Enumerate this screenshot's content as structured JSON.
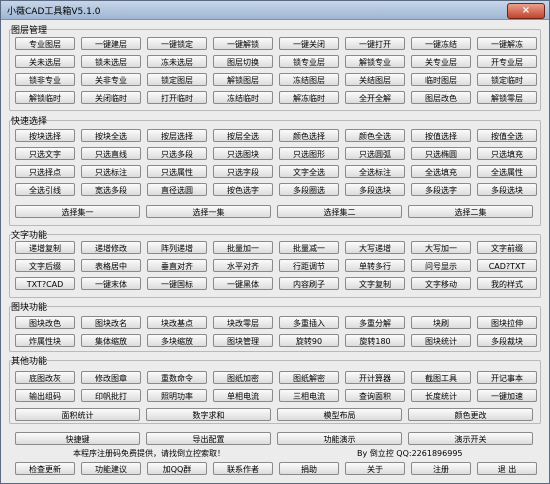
{
  "window": {
    "title": "小薇CAD工具箱V5.1.0",
    "close_symbol": "×"
  },
  "sections": {
    "layers": {
      "label": "图层管理",
      "buttons": [
        "专业图层",
        "一键建层",
        "一键锁定",
        "一键解锁",
        "一键关闭",
        "一键打开",
        "一键冻结",
        "一键解冻",
        "关未选层",
        "锁未选层",
        "冻未选层",
        "图层切换",
        "锁专业层",
        "解锁专业",
        "关专业层",
        "开专业层",
        "锁非专业",
        "关非专业",
        "锁定图层",
        "解锁图层",
        "冻结图层",
        "关结图层",
        "临时图层",
        "锁定临时",
        "解锁临时",
        "关闭临时",
        "打开临时",
        "冻结临时",
        "解冻临时",
        "全开全解",
        "图层改色",
        "解锁零层"
      ]
    },
    "select": {
      "label": "快速选择",
      "buttons": [
        "按块选择",
        "按块全选",
        "按层选择",
        "按层全选",
        "颜色选择",
        "颜色全选",
        "按值选择",
        "按值全选",
        "只选文字",
        "只选直线",
        "只选多段",
        "只选图块",
        "只选图形",
        "只选圆弧",
        "只选椭圆",
        "只选填充",
        "只选择点",
        "只选标注",
        "只选属性",
        "只选字段",
        "文字全选",
        "全选标注",
        "全选填充",
        "全选属性",
        "全选引线",
        "宽选多段",
        "直径选圆",
        "按色选字",
        "多段圈选",
        "多段选块",
        "多段选字",
        "多段选块"
      ],
      "sets": [
        "选择集一",
        "选择一集",
        "选择集二",
        "选择二集"
      ]
    },
    "text": {
      "label": "文字功能",
      "buttons": [
        "递增复制",
        "递增修改",
        "阵列递增",
        "批量加一",
        "批量减一",
        "大写递增",
        "大写加一",
        "文字前缀",
        "文字后缀",
        "表格居中",
        "垂直对齐",
        "水平对齐",
        "行距调节",
        "单转多行",
        "问号显示",
        "CAD?TXT",
        "TXT?CAD",
        "一键末体",
        "一键国标",
        "一键黑体",
        "内容刷子",
        "文字复制",
        "文字移动",
        "我的样式"
      ]
    },
    "blocks": {
      "label": "图块功能",
      "buttons": [
        "图块改色",
        "图块改名",
        "块改基点",
        "块改零层",
        "多重插入",
        "多重分解",
        "块刷",
        "图块拉伸",
        "炸属性块",
        "集体缩放",
        "多块缩放",
        "图块管理",
        "旋转90",
        "旋转180",
        "图块统计",
        "多段裁块"
      ]
    },
    "other": {
      "label": "其他功能",
      "buttons": [
        "底图改灰",
        "修改图章",
        "重数命令",
        "图纸加密",
        "图纸解密",
        "开计算器",
        "截图工具",
        "开记事本",
        "输出组码",
        "印帆批打",
        "照明功率",
        "单相电流",
        "三相电流",
        "查询面积",
        "长度统计",
        "一键加速"
      ],
      "wide": [
        "面积统计",
        "数字求和",
        "模型布局",
        "颜色更改"
      ]
    }
  },
  "bottom": {
    "row1": [
      "快捷键",
      "导出配置",
      "功能演示",
      "演示开关"
    ],
    "notice": "本程序注册码免费提供，请找倒立控索取！",
    "author": "By 倒立控 QQ:2261896995",
    "row2": [
      "检查更新",
      "功能建议",
      "加QQ群",
      "联系作者",
      "捐助",
      "关于",
      "注册",
      "退 出"
    ]
  }
}
